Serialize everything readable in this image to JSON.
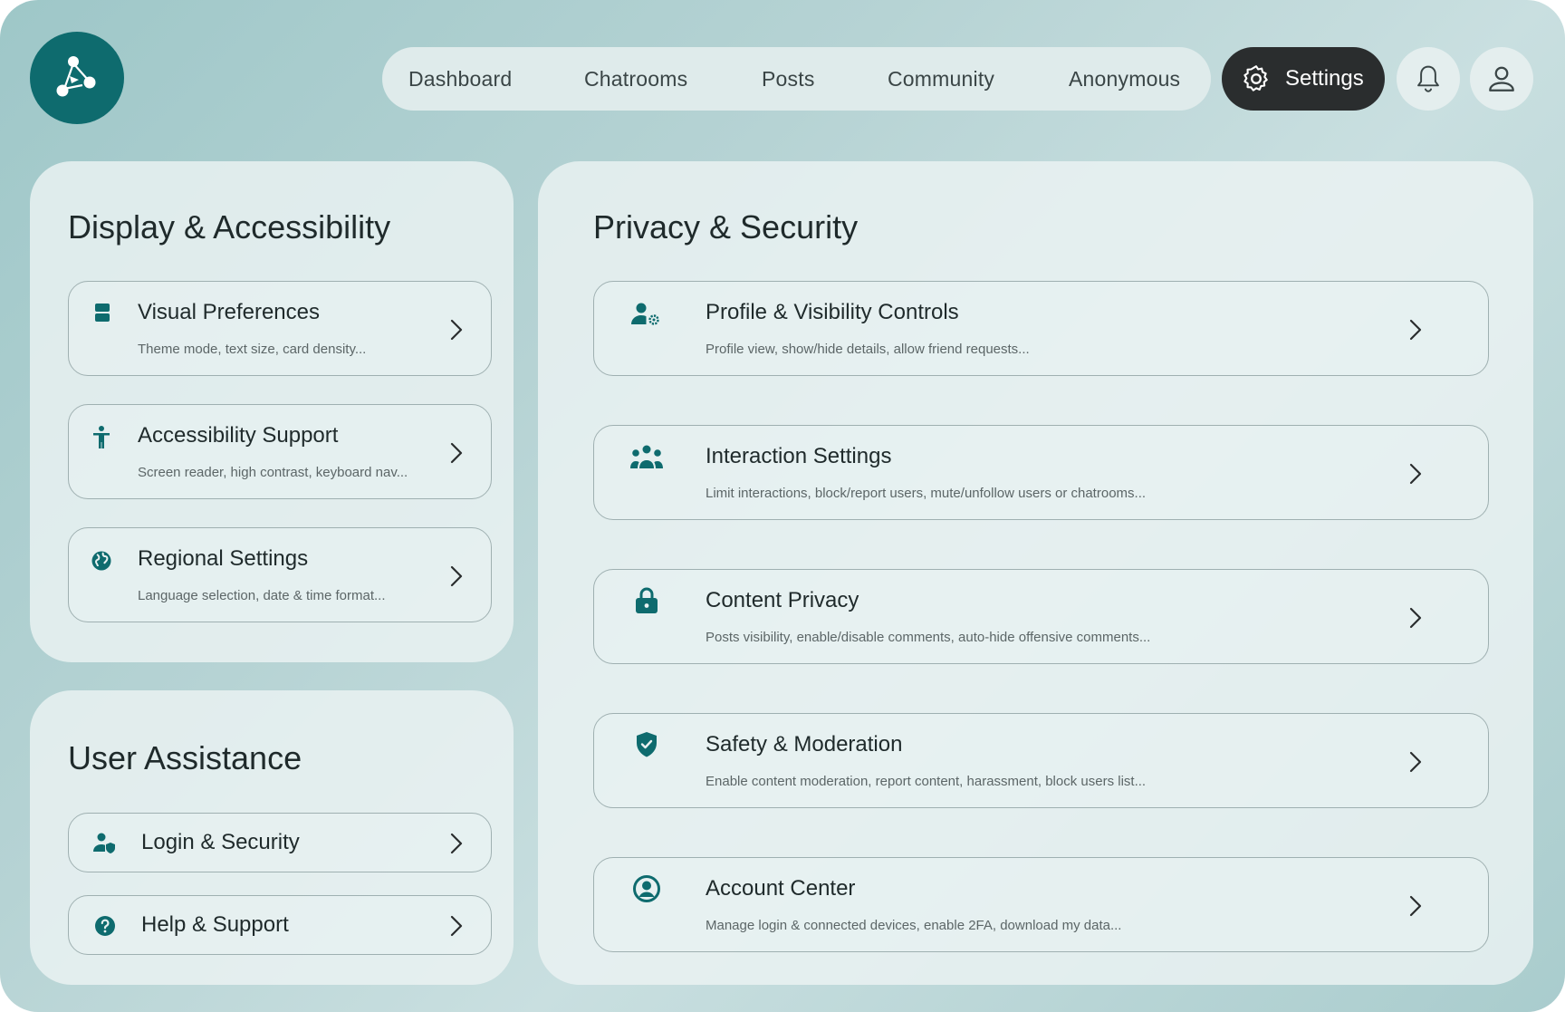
{
  "nav": {
    "items": [
      "Dashboard",
      "Chatrooms",
      "Posts",
      "Community",
      "Anonymous"
    ],
    "settings_label": "Settings"
  },
  "display": {
    "title": "Display & Accessibility",
    "items": [
      {
        "title": "Visual Preferences",
        "desc": "Theme mode, text size, card density...",
        "icon": "palette-icon"
      },
      {
        "title": "Accessibility Support",
        "desc": "Screen reader, high contrast, keyboard nav...",
        "icon": "accessibility-icon"
      },
      {
        "title": "Regional Settings",
        "desc": "Language selection, date & time format...",
        "icon": "globe-icon"
      }
    ]
  },
  "assistance": {
    "title": "User Assistance",
    "items": [
      {
        "title": "Login & Security",
        "icon": "user-shield-icon"
      },
      {
        "title": "Help & Support",
        "icon": "help-icon"
      }
    ]
  },
  "privacy": {
    "title": "Privacy & Security",
    "items": [
      {
        "title": "Profile & Visibility Controls",
        "desc": "Profile view, show/hide details, allow friend requests...",
        "icon": "user-gear-icon"
      },
      {
        "title": "Interaction Settings",
        "desc": "Limit interactions, block/report users, mute/unfollow users or chatrooms...",
        "icon": "group-icon"
      },
      {
        "title": "Content Privacy",
        "desc": "Posts visibility, enable/disable comments, auto-hide offensive comments...",
        "icon": "lock-icon"
      },
      {
        "title": "Safety & Moderation",
        "desc": "Enable content moderation, report content, harassment, block users list...",
        "icon": "shield-check-icon"
      },
      {
        "title": "Account Center",
        "desc": "Manage login & connected devices, enable 2FA, download my data...",
        "icon": "account-circle-icon"
      }
    ]
  },
  "colors": {
    "accent": "#0e6b6e",
    "dark": "#2a2d2e"
  }
}
